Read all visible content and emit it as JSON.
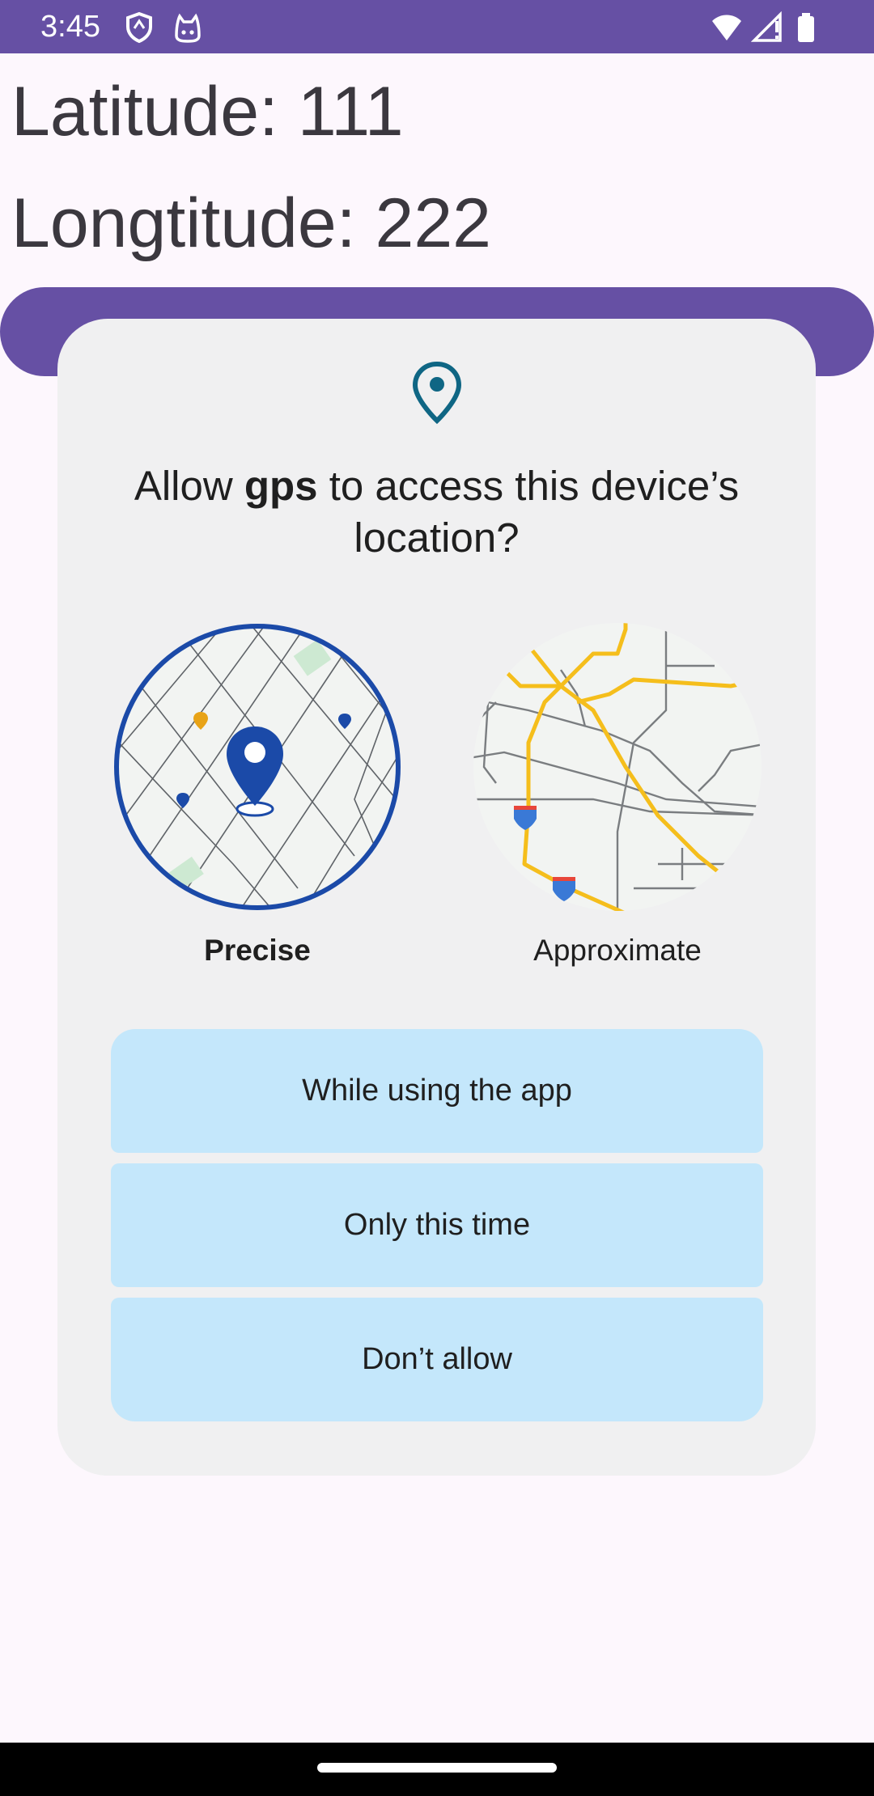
{
  "status_bar": {
    "time": "3:45",
    "left_icons": [
      "shield-icon",
      "cat-face-icon"
    ],
    "right_icons": [
      "wifi-icon",
      "signal-icon",
      "battery-icon"
    ],
    "color": "#6650a4"
  },
  "app": {
    "latitude_text": "Latitude: 111",
    "longitude_text": "Longtitude: 222"
  },
  "dialog": {
    "icon": "location-pin-icon",
    "title_prefix": "Allow ",
    "title_app": "gps",
    "title_suffix": " to access this device’s location?",
    "precision_options": [
      {
        "label": "Precise",
        "selected": true
      },
      {
        "label": "Approximate",
        "selected": false
      }
    ],
    "buttons": [
      {
        "label": "While using the app"
      },
      {
        "label": "Only this time"
      },
      {
        "label": "Don’t allow"
      }
    ],
    "colors": {
      "background": "#f0f0f1",
      "button": "#c4e7fb",
      "accent": "#1b4aa8",
      "route": "#f5be1c"
    }
  }
}
